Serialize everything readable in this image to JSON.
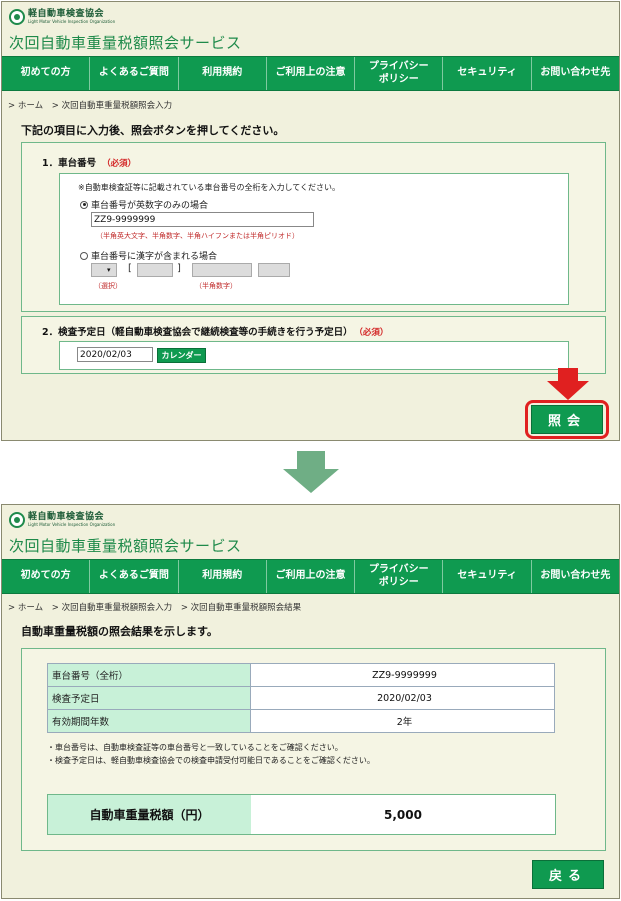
{
  "logo": {
    "org_ja": "軽自動車検査協会",
    "org_en": "Light Motor Vehicle Inspection Organization"
  },
  "site_title": "次回自動車重量税額照会サービス",
  "nav": [
    {
      "label": "初めての方"
    },
    {
      "label": "よくあるご質問"
    },
    {
      "label": "利用規約"
    },
    {
      "label": "ご利用上の注意"
    },
    {
      "label": "プライバシー\nポリシー"
    },
    {
      "label": "セキュリティ"
    },
    {
      "label": "お問い合わせ先"
    }
  ],
  "screen1": {
    "breadcrumb": [
      "> ホーム",
      "> 次回自動車重量税額照会入力"
    ],
    "heading": "下記の項目に入力後、照会ボタンを押してください。",
    "section1": {
      "label": "1．車台番号",
      "required": "（必須）",
      "note": "※自動車検査証等に記載されている車台番号の全桁を入力してください。",
      "option_alnum": "車台番号が英数字のみの場合",
      "alnum_value": "ZZ9-9999999",
      "alnum_hint": "（半角英大文字、半角数字、半角ハイフンまたは半角ピリオド）",
      "option_kanji": "車台番号に漢字が含まれる場合",
      "select_hint": "（選択）",
      "digits_hint": "（半角数字）",
      "bracket_open": "[",
      "bracket_close": "]"
    },
    "section2": {
      "label": "2．検査予定日（軽自動車検査協会で継続検査等の手続きを行う予定日）",
      "required": "（必須）",
      "date_value": "2020/02/03",
      "calendar_button": "カレンダー"
    },
    "submit_button": "照会"
  },
  "screen2": {
    "breadcrumb": [
      "> ホーム",
      "> 次回自動車重量税額照会入力",
      "> 次回自動車重量税額照会結果"
    ],
    "heading": "自動車重量税額の照会結果を示します。",
    "rows": [
      {
        "key": "車台番号（全桁）",
        "value": "ZZ9-9999999"
      },
      {
        "key": "検査予定日",
        "value": "2020/02/03"
      },
      {
        "key": "有効期間年数",
        "value": "2年"
      }
    ],
    "notes": [
      "・車台番号は、自動車検査証等の車台番号と一致していることをご確認ください。",
      "・検査予定日は、軽自動車検査協会での検査申請受付可能日であることをご確認ください。"
    ],
    "tax_label": "自動車重量税額（円）",
    "tax_value": "5,000",
    "back_button": "戻る"
  },
  "colors": {
    "brand_green": "#0f9a50",
    "panel_bg": "#f1f1dd",
    "accent_red": "#e02020",
    "table_key_bg": "#c8f1d8"
  }
}
